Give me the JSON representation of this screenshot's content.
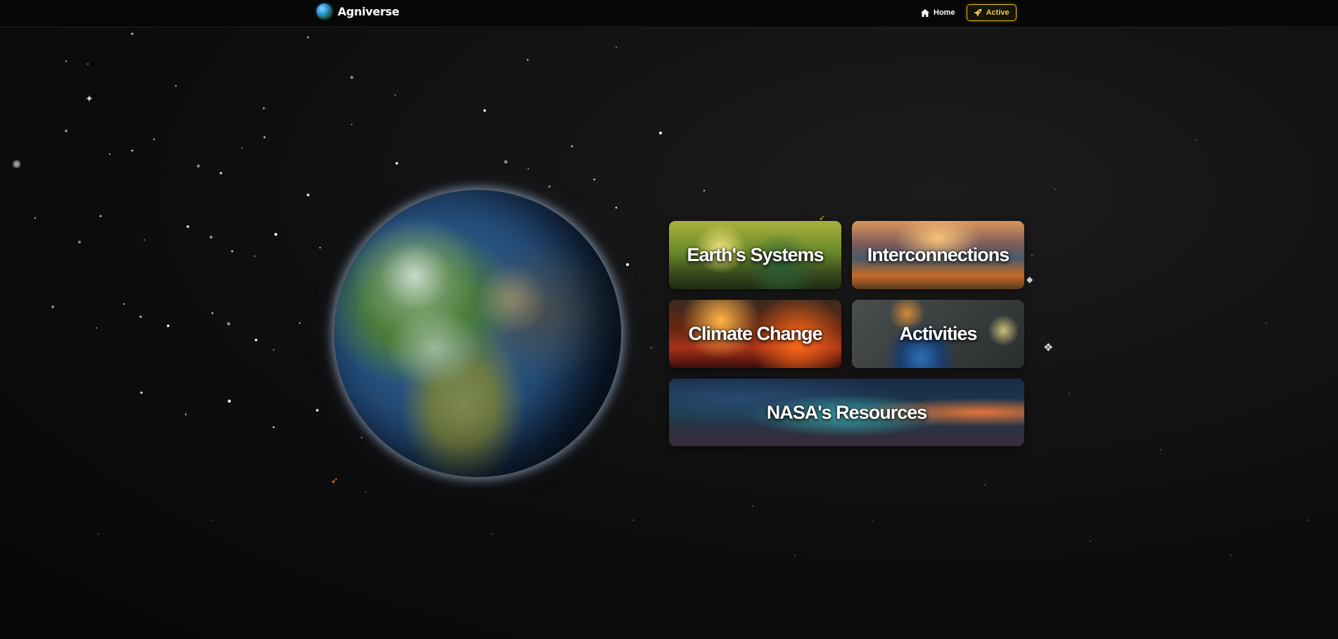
{
  "header": {
    "brand_name": "Agniverse",
    "nav": {
      "home_label": "Home",
      "active_label": "Active"
    }
  },
  "hero": {
    "globe_icon": "earth-globe",
    "cards": [
      {
        "title": "Earth's Systems"
      },
      {
        "title": "Interconnections"
      },
      {
        "title": "Climate Change"
      },
      {
        "title": "Activities"
      },
      {
        "title": "NASA's Resources"
      }
    ]
  },
  "colors": {
    "accent": "#e8c210",
    "background": "#0e0e0e"
  }
}
